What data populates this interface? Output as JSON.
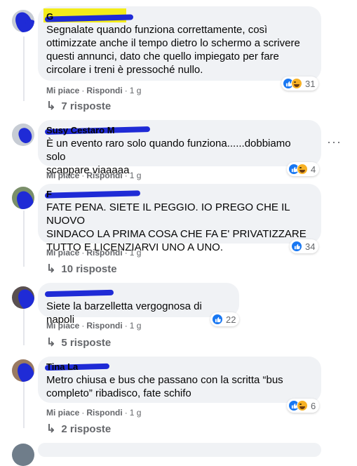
{
  "comments": [
    {
      "author": "G",
      "text": [
        "Segnalate quando funziona correttamente, così",
        "ottimizzate anche il tempo dietro lo schermo a scrivere",
        "questi annunci, dato che quello impiegato per fare",
        "circolare i treni è pressoché nullo."
      ],
      "like": "Mi piace",
      "reply": "Rispondi",
      "time": "1 g",
      "reactions": "31",
      "reaction_icons": [
        "like-icon",
        "laugh-icon"
      ],
      "replies": "7 risposte"
    },
    {
      "author": "Susy Cestaro M",
      "text": [
        "È un evento raro solo quando funziona......dobbiamo solo",
        "scappare viaaaaa"
      ],
      "like": "Mi piace",
      "reply": "Rispondi",
      "time": "1 g",
      "reactions": "4",
      "reaction_icons": [
        "like-icon",
        "laugh-icon"
      ],
      "replies": ""
    },
    {
      "author": "F",
      "text": [
        "FATE PENA. SIETE IL PEGGIO. IO PREGO CHE IL NUOVO",
        "SINDACO LA PRIMA COSA CHE FA E' PRIVATIZZARE",
        "TUTTO E LICENZIARVI UNO A UNO."
      ],
      "like": "Mi piace",
      "reply": "Rispondi",
      "time": "1 g",
      "reactions": "34",
      "reaction_icons": [
        "like-icon"
      ],
      "replies": "10 risposte"
    },
    {
      "author": "",
      "text": [
        "Siete la barzelletta vergognosa di napoli"
      ],
      "like": "Mi piace",
      "reply": "Rispondi",
      "time": "1 g",
      "reactions": "22",
      "reaction_icons": [
        "like-icon"
      ],
      "replies": "5 risposte"
    },
    {
      "author": "Tina La",
      "text": [
        "Metro chiusa e bus che passano con la scritta “bus",
        "completo” ribadisco, fate schifo"
      ],
      "like": "Mi piace",
      "reply": "Rispondi",
      "time": "1 g",
      "reactions": "6",
      "reaction_icons": [
        "like-icon",
        "laugh-icon"
      ],
      "replies": "2 risposte"
    }
  ],
  "colors": {
    "bubble": "#f0f2f5",
    "meta": "#65676b",
    "like": "#1877f2",
    "haha": "#f7b125",
    "redaction": "#1f2bd6",
    "highlight": "#f3ec19"
  }
}
